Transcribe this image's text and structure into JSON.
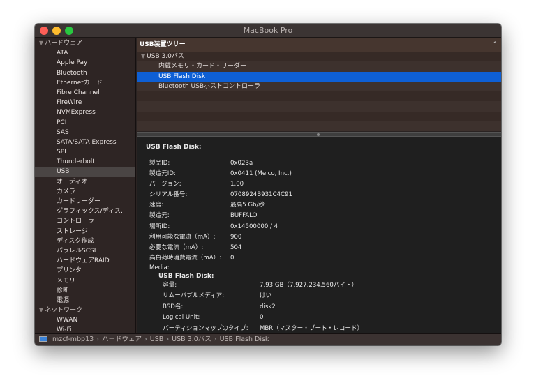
{
  "window": {
    "title": "MacBook Pro"
  },
  "sidebar": {
    "items": [
      {
        "label": "ハードウェア",
        "group": true
      },
      {
        "label": "ATA"
      },
      {
        "label": "Apple Pay"
      },
      {
        "label": "Bluetooth"
      },
      {
        "label": "Ethernetカード"
      },
      {
        "label": "Fibre Channel"
      },
      {
        "label": "FireWire"
      },
      {
        "label": "NVMExpress"
      },
      {
        "label": "PCI"
      },
      {
        "label": "SAS"
      },
      {
        "label": "SATA/SATA Express"
      },
      {
        "label": "SPI"
      },
      {
        "label": "Thunderbolt"
      },
      {
        "label": "USB",
        "selected": true
      },
      {
        "label": "オーディオ"
      },
      {
        "label": "カメラ"
      },
      {
        "label": "カードリーダー"
      },
      {
        "label": "グラフィックス/ディス…"
      },
      {
        "label": "コントローラ"
      },
      {
        "label": "ストレージ"
      },
      {
        "label": "ディスク作成"
      },
      {
        "label": "パラレルSCSI"
      },
      {
        "label": "ハードウェアRAID"
      },
      {
        "label": "プリンタ"
      },
      {
        "label": "メモリ"
      },
      {
        "label": "診断"
      },
      {
        "label": "電源"
      },
      {
        "label": "ネットワーク",
        "group": true
      },
      {
        "label": "WWAN"
      },
      {
        "label": "Wi-Fi"
      }
    ]
  },
  "tree": {
    "header": "USB装置ツリー",
    "rows": [
      {
        "label": "USB 3.0バス",
        "root": true
      },
      {
        "label": "内蔵メモリ・カード・リーダー"
      },
      {
        "label": "USB Flash Disk",
        "selected": true
      },
      {
        "label": "Bluetooth USBホストコントローラ"
      },
      {
        "label": ""
      },
      {
        "label": ""
      },
      {
        "label": ""
      },
      {
        "label": ""
      }
    ]
  },
  "detail": {
    "title": "USB Flash Disk:",
    "rows": [
      {
        "k": "製品ID:",
        "v": "0x023a"
      },
      {
        "k": "製造元ID:",
        "v": "0x0411  (Melco, Inc.)"
      },
      {
        "k": "バージョン:",
        "v": "1.00"
      },
      {
        "k": "シリアル番号:",
        "v": "0708924B931C4C91"
      },
      {
        "k": "速度:",
        "v": "最高5 Gb/秒"
      },
      {
        "k": "製造元:",
        "v": "BUFFALO"
      },
      {
        "k": "場所ID:",
        "v": "0x14500000 / 4"
      },
      {
        "k": "利用可能な電流（mA）:",
        "v": "900"
      },
      {
        "k": "必要な電流（mA）:",
        "v": "504"
      },
      {
        "k": "高負荷時消費電流（mA）:",
        "v": "0"
      }
    ],
    "media_label": "Media:",
    "media_title": "USB Flash Disk:",
    "media_rows": [
      {
        "k": "容量:",
        "v": "7.93 GB（7,927,234,560バイト）"
      },
      {
        "k": "リムーバブルメディア:",
        "v": "はい"
      },
      {
        "k": "BSD名:",
        "v": "disk2"
      },
      {
        "k": "Logical Unit:",
        "v": "0"
      },
      {
        "k": "パーティションマップのタイプ:",
        "v": "MBR（マスター・ブート・レコード）"
      }
    ]
  },
  "status": {
    "path": [
      "mzcf-mbp13",
      "ハードウェア",
      "USB",
      "USB 3.0バス",
      "USB Flash Disk"
    ]
  },
  "colors": {
    "selection": "#0e5fd4",
    "close": "#fe5f57",
    "minimize": "#febc2e",
    "zoom": "#28c840"
  }
}
